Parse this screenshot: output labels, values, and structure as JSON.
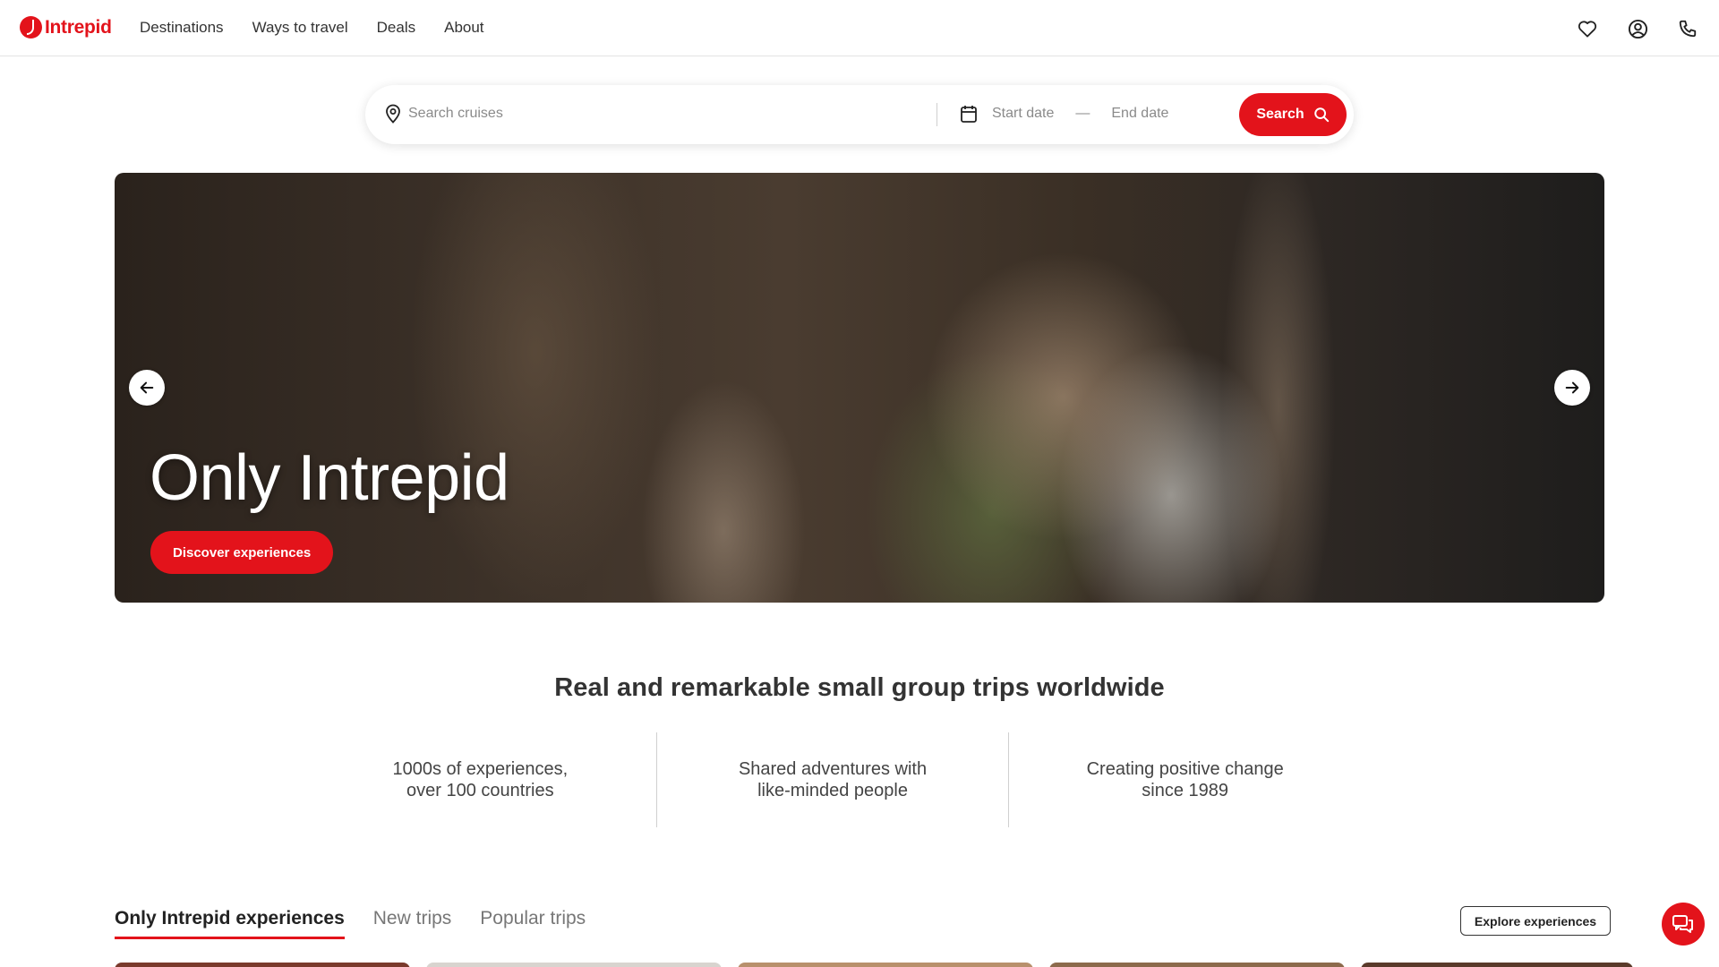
{
  "header": {
    "brand": "Intrepid",
    "nav": [
      "Destinations",
      "Ways to travel",
      "Deals",
      "About"
    ],
    "icons": [
      "heart-icon",
      "account-icon",
      "phone-icon"
    ]
  },
  "search": {
    "placeholder": "Search cruises",
    "start_date": "Start date",
    "dash": "—",
    "end_date": "End date",
    "button_label": "Search"
  },
  "hero": {
    "title": "Only Intrepid",
    "cta": "Discover experiences"
  },
  "tagline": "Real and remarkable small group trips worldwide",
  "features": [
    "1000s of experiences,\nover 100 countries",
    "Shared adventures with\nlike-minded people",
    "Creating positive change\nsince 1989"
  ],
  "tabs": {
    "items": [
      "Only Intrepid experiences",
      "New trips",
      "Popular trips"
    ],
    "active": 0,
    "explore_label": "Explore experiences"
  },
  "colors": {
    "brand_red": "#e3131b",
    "text": "#333333"
  }
}
